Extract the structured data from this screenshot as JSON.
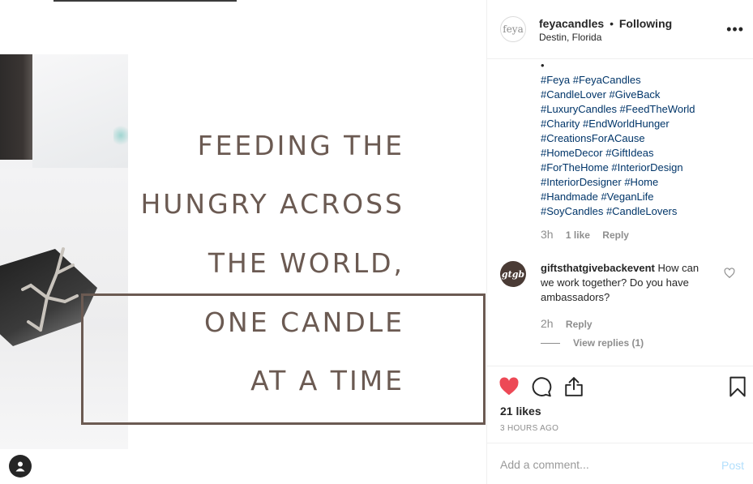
{
  "post": {
    "headline": [
      "FEEDING THE",
      "HUNGRY ACROSS",
      "THE WORLD,",
      "ONE CANDLE",
      "AT A TIME"
    ]
  },
  "header": {
    "avatar_text": "feya",
    "username": "feyacandles",
    "separator": "•",
    "follow_status": "Following",
    "location": "Destin, Florida"
  },
  "caption": {
    "bullet": "•",
    "hashtag_lines": [
      "#Feya #FeyaCandles",
      "#CandleLover #GiveBack",
      "#LuxuryCandles #FeedTheWorld",
      "#Charity #EndWorldHunger",
      "#CreationsForACause",
      "#HomeDecor #GiftIdeas",
      "#ForTheHome #InteriorDesign",
      "#InteriorDesigner #Home",
      "#Handmade #VeganLife",
      "#SoyCandles #CandleLovers"
    ],
    "time": "3h",
    "likes": "1 like",
    "reply": "Reply"
  },
  "comment": {
    "avatar_text": "gtgb",
    "username": "giftsthatgivebackevent",
    "text": "How can we work together? Do you have ambassadors?",
    "time": "2h",
    "reply": "Reply",
    "view_replies": "View replies (1)"
  },
  "actions": {
    "like_count": "21 likes",
    "time_ago": "3 HOURS AGO",
    "liked_color": "#ed4956"
  },
  "add_comment": {
    "placeholder": "Add a comment...",
    "post_label": "Post"
  }
}
